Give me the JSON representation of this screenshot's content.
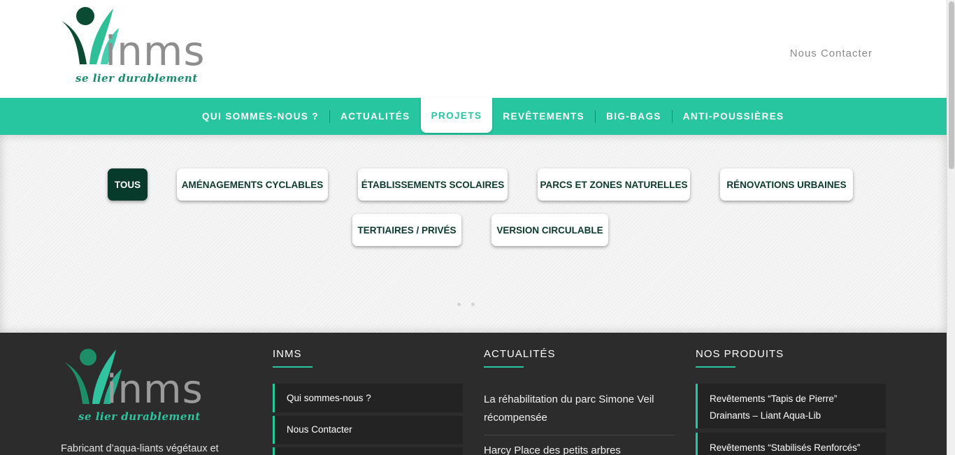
{
  "brand": {
    "name": "inms",
    "tagline": "se lier durablement",
    "colors": {
      "accent": "#27c6a1",
      "dark_green": "#073a2b",
      "logo_green": "#1a8a6d",
      "footer_bg": "#2c2c2c"
    }
  },
  "header": {
    "contact_link": "Nous Contacter"
  },
  "nav": {
    "items": [
      {
        "label": "QUI SOMMES-NOUS ?"
      },
      {
        "label": "ACTUALITÉS"
      },
      {
        "label": "PROJETS",
        "active": true
      },
      {
        "label": "REVÊTEMENTS"
      },
      {
        "label": "BIG-BAGS"
      },
      {
        "label": "ANTI-POUSSIÈRES"
      }
    ]
  },
  "filters": {
    "items": [
      {
        "label": "TOUS",
        "active": true
      },
      {
        "label": "AMÉNAGEMENTS CYCLABLES"
      },
      {
        "label": "ÉTABLISSEMENTS SCOLAIRES"
      },
      {
        "label": "PARCS ET ZONES NATURELLES"
      },
      {
        "label": "RÉNOVATIONS URBAINES"
      },
      {
        "label": "TERTIAIRES / PRIVÉS"
      },
      {
        "label": "VERSION CIRCULABLE"
      }
    ]
  },
  "footer": {
    "description": "Fabricant d’aqua-liants végétaux et",
    "columns": {
      "inms": {
        "title": "INMS",
        "links": [
          "Qui sommes-nous ?",
          "Nous Contacter"
        ]
      },
      "news": {
        "title": "ACTUALITÉS",
        "items": [
          "La réhabilitation du parc Simone Veil récompensée",
          "Harcy Place des petits arbres"
        ]
      },
      "products": {
        "title": "NOS PRODUITS",
        "items": [
          "Revêtements “Tapis de Pierre” Drainants – Liant Aqua-Lib",
          "Revêtements “Stabilisés Renforcés”"
        ]
      }
    }
  }
}
